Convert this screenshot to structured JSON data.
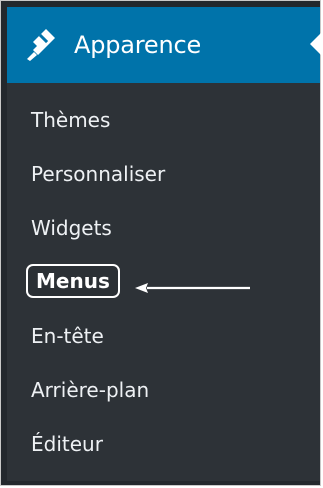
{
  "header": {
    "title": "Apparence",
    "icon": "paintbrush-icon",
    "bg_color": "#0073aa"
  },
  "menu": {
    "items": [
      {
        "label": "Thèmes"
      },
      {
        "label": "Personnaliser"
      },
      {
        "label": "Widgets"
      },
      {
        "label": "Menus",
        "current": true
      },
      {
        "label": "En-tête"
      },
      {
        "label": "Arrière-plan"
      },
      {
        "label": "Éditeur"
      }
    ]
  },
  "annotation": {
    "type": "arrow-left",
    "color": "#ffffff"
  }
}
